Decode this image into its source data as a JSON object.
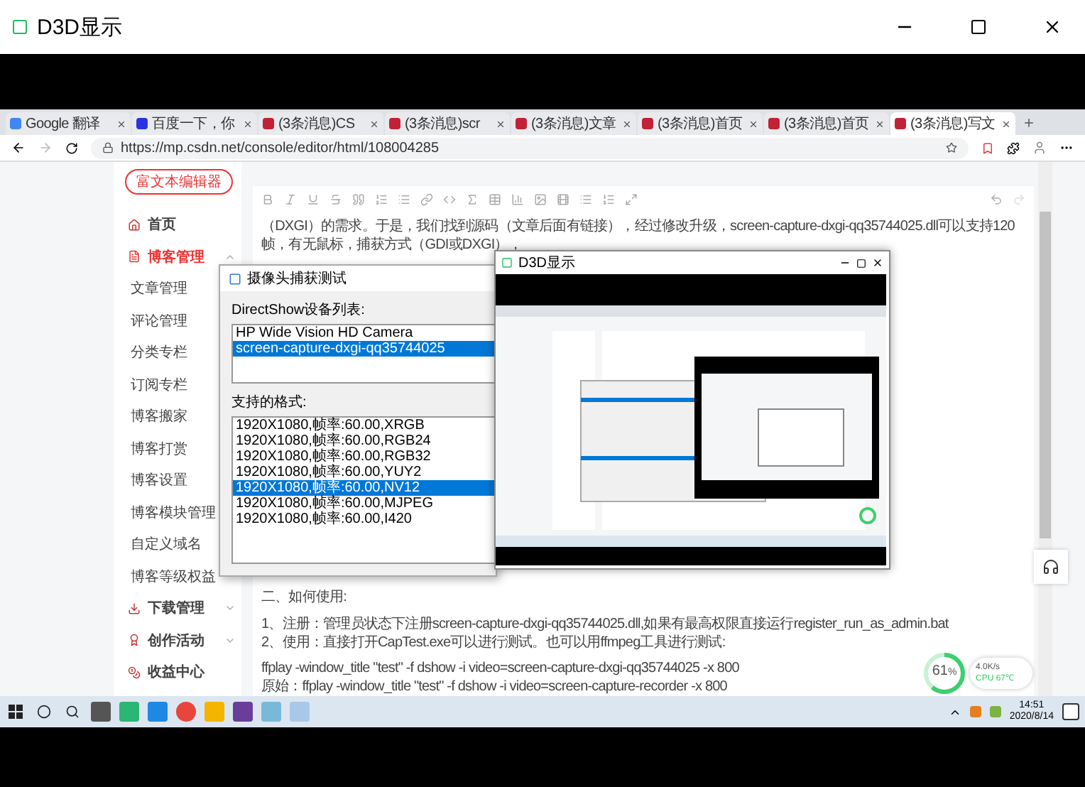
{
  "window": {
    "title": "D3D显示"
  },
  "browser": {
    "tabs": [
      {
        "label": "Google 翻译",
        "kind": "google",
        "selected": false
      },
      {
        "label": "百度一下，你",
        "kind": "baidu",
        "selected": false
      },
      {
        "label": "(3条消息)CS",
        "kind": "csdn",
        "selected": false
      },
      {
        "label": "(3条消息)scr",
        "kind": "csdn",
        "selected": false
      },
      {
        "label": "(3条消息)文章",
        "kind": "csdn",
        "selected": false
      },
      {
        "label": "(3条消息)首页",
        "kind": "csdn",
        "selected": false
      },
      {
        "label": "(3条消息)首页",
        "kind": "csdn",
        "selected": false
      },
      {
        "label": "(3条消息)写文",
        "kind": "csdn",
        "selected": true
      }
    ],
    "url": "https://mp.csdn.net/console/editor/html/108004285"
  },
  "sidebar": {
    "editor_button": "富文本编辑器",
    "items": [
      {
        "label": "首页",
        "kind": "section",
        "active": false
      },
      {
        "label": "博客管理",
        "kind": "section",
        "active": true,
        "expanded": true,
        "children": [
          {
            "label": "文章管理"
          },
          {
            "label": "评论管理"
          },
          {
            "label": "分类专栏"
          },
          {
            "label": "订阅专栏"
          },
          {
            "label": "博客搬家"
          },
          {
            "label": "博客打赏"
          },
          {
            "label": "博客设置"
          },
          {
            "label": "博客模块管理"
          },
          {
            "label": "自定义域名"
          },
          {
            "label": "博客等级权益"
          }
        ]
      },
      {
        "label": "下载管理",
        "kind": "section",
        "active": false,
        "expanded": false
      },
      {
        "label": "创作活动",
        "kind": "section",
        "active": false,
        "expanded": false
      },
      {
        "label": "收益中心",
        "kind": "section",
        "active": false
      }
    ]
  },
  "editor": {
    "intro": [
      "（DXGI）的需求。于是，我们找到源码（文章后面有链接），经过修改升级，screen-capture-dxgi-qq35744025.dll可以支持120",
      "帧，有无鼠标，捕获方式（GDI或DXGI），"
    ],
    "heading": "二、如何使用:",
    "steps": [
      "1、注册：管理员状态下注册screen-capture-dxgi-qq35744025.dll,如果有最高权限直接运行register_run_as_admin.bat",
      "2、使用：直接打开CapTest.exe可以进行测试。也可以用ffmpeg工具进行测试:"
    ],
    "commands": [
      "ffplay -window_title \"test\"  -f dshow   -i video=screen-capture-dxgi-qq35744025 -x 800",
      "原始：ffplay -window_title \"test\" -f dshow   -i video=screen-capture-recorder -x 800"
    ]
  },
  "dialog": {
    "title": "摄像头捕获测试",
    "device_label": "DirectShow设备列表:",
    "devices": [
      {
        "label": "HP Wide Vision HD Camera",
        "selected": false
      },
      {
        "label": "screen-capture-dxgi-qq35744025",
        "selected": true
      }
    ],
    "format_label": "支持的格式:",
    "formats": [
      {
        "label": "1920X1080,帧率:60.00,XRGB",
        "selected": false
      },
      {
        "label": "1920X1080,帧率:60.00,RGB24",
        "selected": false
      },
      {
        "label": "1920X1080,帧率:60.00,RGB32",
        "selected": false
      },
      {
        "label": "1920X1080,帧率:60.00,YUY2",
        "selected": false
      },
      {
        "label": "1920X1080,帧率:60.00,NV12",
        "selected": true
      },
      {
        "label": "1920X1080,帧率:60.00,MJPEG",
        "selected": false
      },
      {
        "label": "1920X1080,帧率:60.00,I420",
        "selected": false
      }
    ]
  },
  "nested_window": {
    "title": "D3D显示"
  },
  "meter": {
    "reading": "61",
    "unit": "%",
    "level": 0.61
  },
  "net": {
    "speed": "4.0K/s",
    "cpu": "CPU 67℃"
  },
  "taskbar": {
    "time": "14:51",
    "date": "2020/8/14"
  }
}
